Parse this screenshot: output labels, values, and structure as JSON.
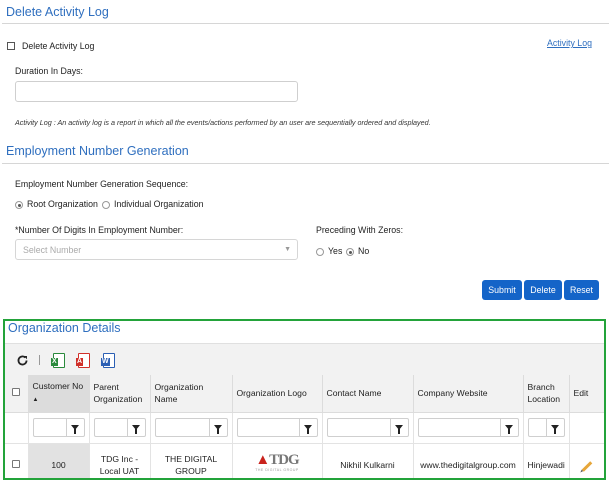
{
  "delete_activity_log": {
    "title": "Delete Activity Log",
    "checkbox_label": "Delete Activity Log",
    "activity_log_link": "Activity Log",
    "duration_label": "Duration In Days:",
    "duration_value": "",
    "note": "Activity Log : An activity log is a report in which all the events/actions performed by an user are sequentially ordered and displayed."
  },
  "employment_number": {
    "title": "Employment Number Generation",
    "sequence_label": "Employment Number Generation Sequence:",
    "sequence_options": [
      "Root Organization",
      "Individual Organization"
    ],
    "sequence_selected": "Root Organization",
    "digits_label": "*Number Of Digits In Employment Number:",
    "digits_placeholder": "Select Number",
    "zeros_label": "Preceding With Zeros:",
    "zeros_options": [
      "Yes",
      "No"
    ],
    "zeros_selected": "No"
  },
  "actions": {
    "submit": "Submit",
    "delete": "Delete",
    "reset": "Reset",
    "primary_color": "#1464c8"
  },
  "org_details": {
    "title": "Organization Details",
    "highlight_color": "#23a33a",
    "toolbar": [
      "refresh-icon",
      "excel-icon",
      "pdf-icon",
      "word-icon"
    ],
    "columns": [
      "Customer No",
      "Parent Organization",
      "Organization Name",
      "Organization Logo",
      "Contact Name",
      "Company Website",
      "Branch Location",
      "Edit"
    ],
    "sort_indicator": "▲",
    "rows": [
      {
        "customer_no": "100",
        "parent_org": "TDG Inc - Local UAT",
        "org_name": "THE DIGITAL GROUP",
        "logo_text": "TDG",
        "logo_sub": "THE DIGITAL GROUP",
        "contact_name": "Nikhil Kulkarni",
        "website": "www.thedigitalgroup.com",
        "branch": "Hinjewadi"
      }
    ]
  }
}
